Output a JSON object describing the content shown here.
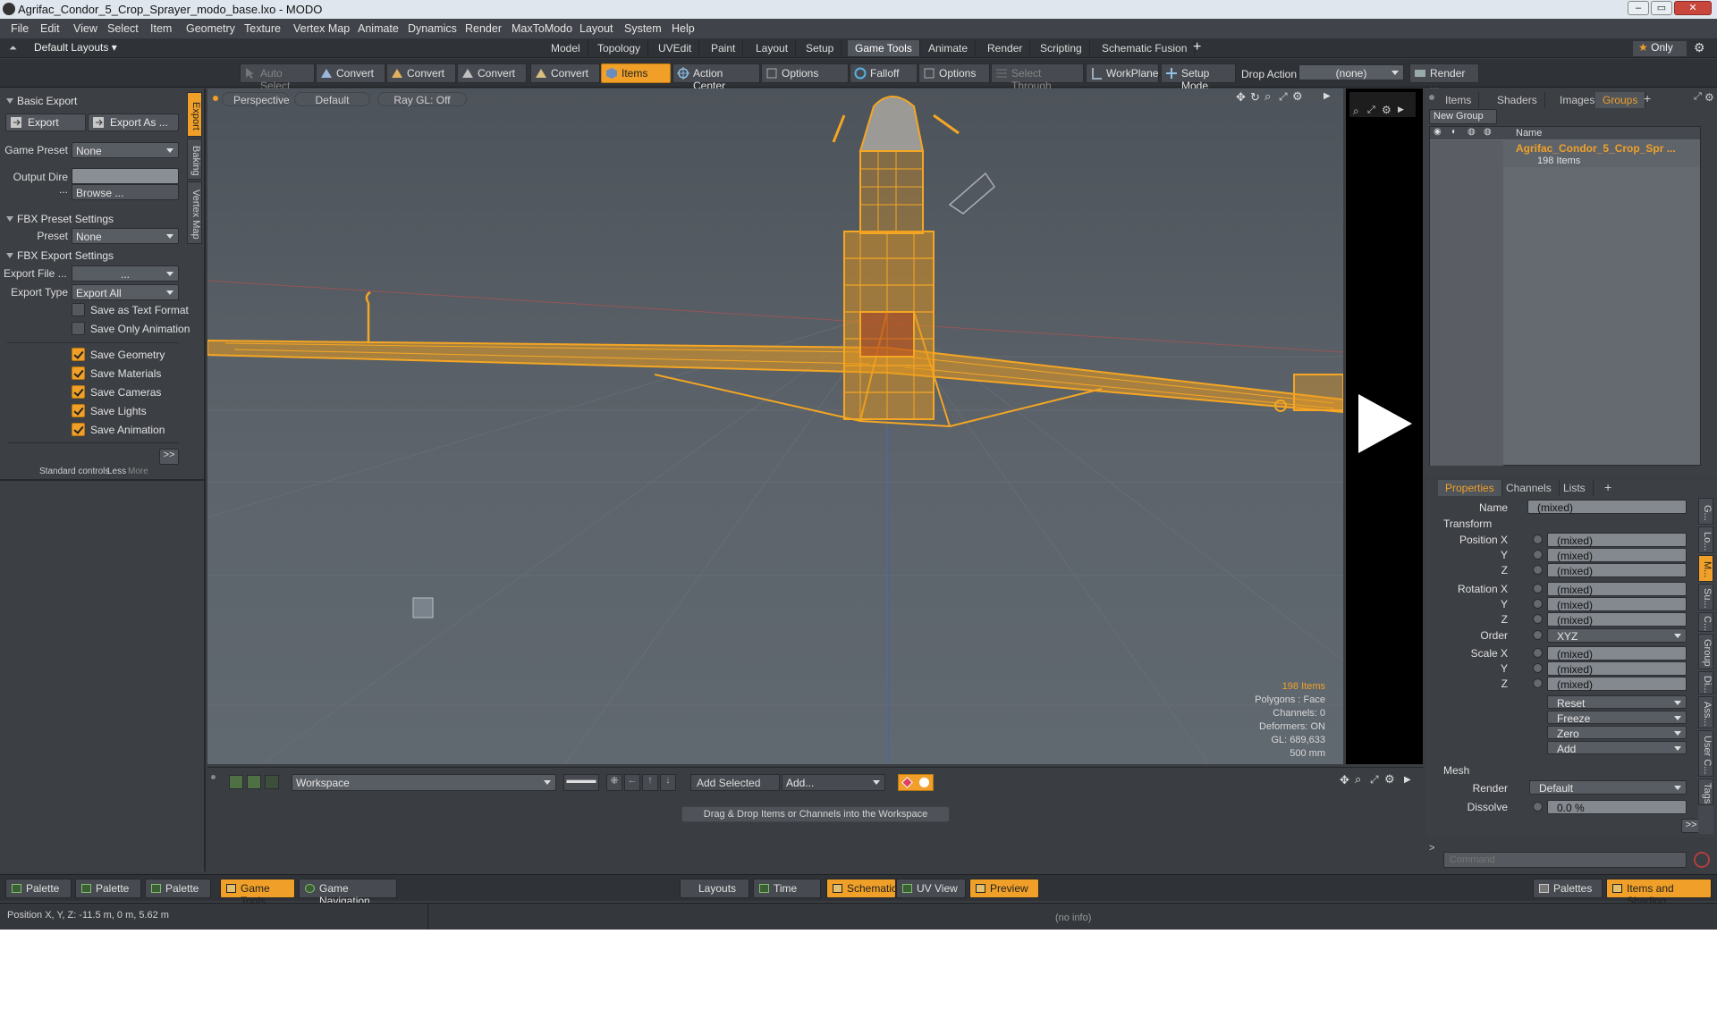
{
  "window": {
    "title": "Agrifac_Condor_5_Crop_Sprayer_modo_base.lxo - MODO"
  },
  "menu": [
    "File",
    "Edit",
    "View",
    "Select",
    "Item",
    "Geometry",
    "Texture",
    "Vertex Map",
    "Animate",
    "Dynamics",
    "Render",
    "MaxToModo",
    "Layout",
    "System",
    "Help"
  ],
  "layouts": {
    "default_label": "Default Layouts",
    "tabs": [
      "Model",
      "Topology",
      "UVEdit",
      "Paint",
      "Layout",
      "Setup",
      "Game Tools",
      "Animate",
      "Render",
      "Scripting",
      "Schematic Fusion"
    ],
    "active_tab": "Game Tools",
    "add_tab": "+",
    "only_label": "Only"
  },
  "toolbar": {
    "auto_select": "Auto Select",
    "convert": "Convert",
    "items": "Items",
    "action_center": "Action Center",
    "options": "Options",
    "falloff": "Falloff",
    "select_through": "Select Through",
    "workplane": "WorkPlane",
    "setup_mode": "Setup Mode",
    "drop_action_label": "Drop Action",
    "drop_action_value": "(none)",
    "render": "Render ..."
  },
  "left_panel": {
    "basic_export": "Basic Export",
    "export_btn": "Export",
    "export_as_btn": "Export As ...",
    "game_preset_label": "Game Preset",
    "game_preset_value": "None",
    "output_dir_label": "Output Dire ...",
    "output_dir_value": "",
    "browse_btn": "Browse ...",
    "fbx_preset_settings": "FBX Preset Settings",
    "preset_label": "Preset",
    "preset_value": "None",
    "fbx_export_settings": "FBX Export Settings",
    "export_file_label": "Export File ...",
    "export_file_value": "...",
    "export_type_label": "Export Type",
    "export_type_value": "Export All",
    "checkboxes": [
      {
        "label": "Save as Text Format",
        "checked": false
      },
      {
        "label": "Save Only Animation",
        "checked": false
      },
      {
        "label": "Save Geometry",
        "checked": true
      },
      {
        "label": "Save Materials",
        "checked": true
      },
      {
        "label": "Save Cameras",
        "checked": true
      },
      {
        "label": "Save Lights",
        "checked": true
      },
      {
        "label": "Save Animation",
        "checked": true
      }
    ],
    "expand_btn": ">>",
    "standard_controls": "Standard controls",
    "less": "Less",
    "more": "More",
    "vtabs": [
      "Export",
      "Baking",
      "Vertex Map"
    ]
  },
  "viewport": {
    "view_type": "Perspective",
    "shading": "Default",
    "raygl": "Ray GL: Off",
    "stats": {
      "items": "198 Items",
      "polygons": "Polygons : Face",
      "channels": "Channels: 0",
      "deformers": "Deformers: ON",
      "gl": "GL: 689,633",
      "scale": "500 mm"
    }
  },
  "right_panel": {
    "tabs": [
      "Items",
      "Shaders",
      "Images",
      "Groups"
    ],
    "active_tab": "Groups",
    "add_tab": "+",
    "new_group_btn": "New Group",
    "name_col": "Name",
    "group_name": "Agrifac_Condor_5_Crop_Spr ...",
    "group_count": "198 Items"
  },
  "properties": {
    "tabs": [
      "Properties",
      "Channels",
      "Lists"
    ],
    "active_tab": "Properties",
    "add_tab": "+",
    "name_label": "Name",
    "name_value": "(mixed)",
    "transform": "Transform",
    "rows": [
      {
        "label": "Position X",
        "value": "(mixed)"
      },
      {
        "label": "Y",
        "value": "(mixed)"
      },
      {
        "label": "Z",
        "value": "(mixed)"
      },
      {
        "label": "Rotation X",
        "value": "(mixed)"
      },
      {
        "label": "Y",
        "value": "(mixed)"
      },
      {
        "label": "Z",
        "value": "(mixed)"
      }
    ],
    "order_label": "Order",
    "order_value": "XYZ",
    "scale_rows": [
      {
        "label": "Scale X",
        "value": "(mixed)"
      },
      {
        "label": "Y",
        "value": "(mixed)"
      },
      {
        "label": "Z",
        "value": "(mixed)"
      }
    ],
    "actions": [
      "Reset",
      "Freeze",
      "Zero",
      "Add"
    ],
    "mesh": "Mesh",
    "render_label": "Render",
    "render_value": "Default",
    "dissolve_label": "Dissolve",
    "dissolve_value": "0.0 %",
    "expand_btn": ">>",
    "command_placeholder": "Command",
    "side_tabs": [
      "G...",
      "Lo...",
      "M...",
      "Su...",
      "C...",
      "Group",
      "Di...",
      "Ass...",
      "User C...",
      "Tags"
    ]
  },
  "workspace": {
    "dropdown": "Workspace",
    "add_selected": "Add Selected",
    "add": "Add...",
    "hint": "Drag & Drop Items or Channels into the Workspace"
  },
  "palette_bar": {
    "left": [
      "Palette",
      "Palette",
      "Palette",
      "Game Tools",
      "Game Navigation"
    ],
    "center": [
      "Layouts",
      "Time",
      "Schematic",
      "UV View",
      "Preview"
    ],
    "right": [
      "Palettes",
      "Items and Shading"
    ]
  },
  "statusbar": {
    "position": "Position X, Y, Z:  -11.5 m, 0 m, 5.62 m",
    "info": "(no info)"
  },
  "colors": {
    "accent": "#f0a028",
    "wire": "#f5a623"
  }
}
